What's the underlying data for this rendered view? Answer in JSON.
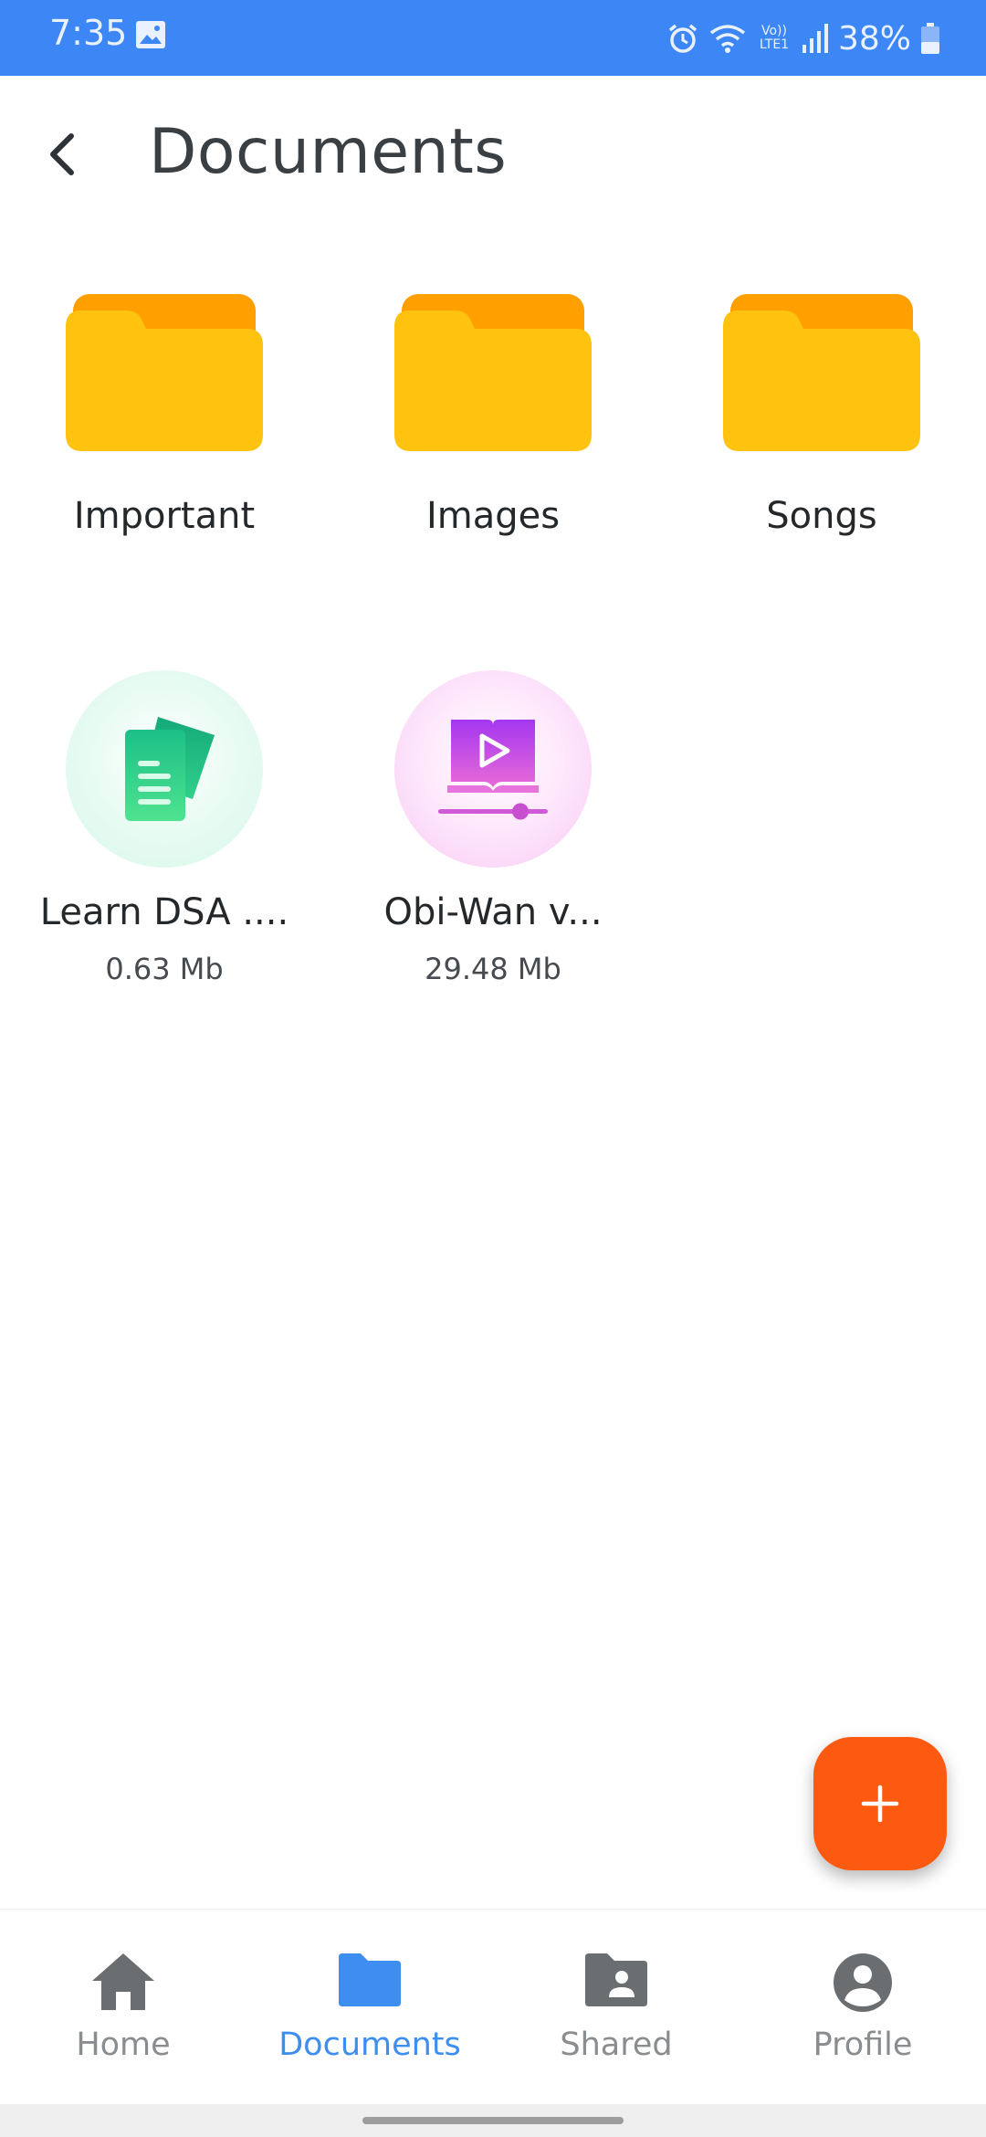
{
  "status": {
    "time": "7:35",
    "battery_text": "38%",
    "network_label": "Vo)) LTE1"
  },
  "header": {
    "title": "Documents"
  },
  "folders": [
    {
      "name": "Important"
    },
    {
      "name": "Images"
    },
    {
      "name": "Songs"
    }
  ],
  "files": [
    {
      "name": "Learn DSA ....",
      "size": "0.63 Mb",
      "icon": "document-icon"
    },
    {
      "name": "Obi-Wan v...",
      "size": "29.48 Mb",
      "icon": "video-lesson-icon"
    }
  ],
  "fab": {
    "icon": "plus-icon"
  },
  "nav": {
    "items": [
      {
        "label": "Home",
        "icon": "home-icon"
      },
      {
        "label": "Documents",
        "icon": "folder-icon"
      },
      {
        "label": "Shared",
        "icon": "shared-folder-icon"
      },
      {
        "label": "Profile",
        "icon": "profile-icon"
      }
    ],
    "active": "Documents"
  },
  "colors": {
    "statusbar": "#3d86f5",
    "folder_front": "#ffc20e",
    "folder_back": "#ff9f00",
    "accent": "#3d8ef0",
    "fab": "#fc5a10"
  }
}
